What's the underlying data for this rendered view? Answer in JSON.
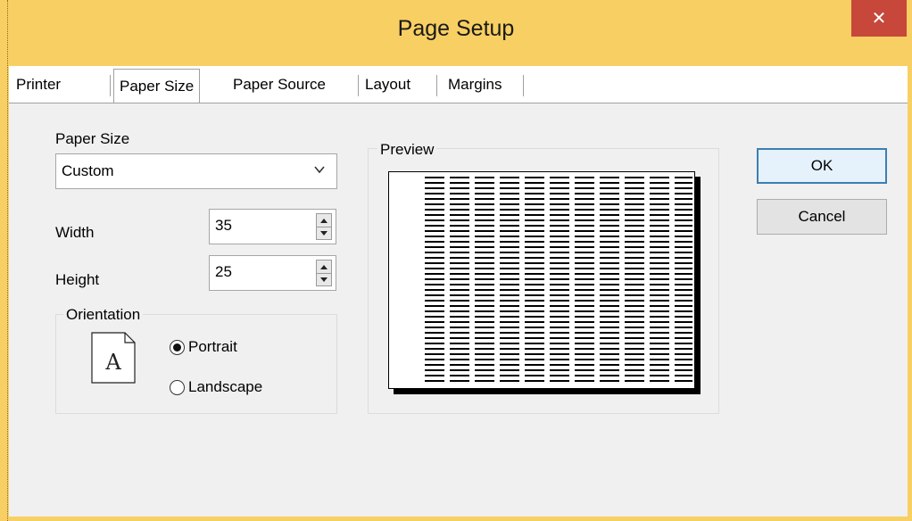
{
  "window": {
    "title": "Page Setup",
    "close_symbol": "✕",
    "accent": "#f8cf62",
    "close_color": "#c7473a"
  },
  "tabs": [
    {
      "label": "Printer",
      "active": false
    },
    {
      "label": "Paper Size",
      "active": true
    },
    {
      "label": "Paper Source",
      "active": false
    },
    {
      "label": "Layout",
      "active": false
    },
    {
      "label": "Margins",
      "active": false
    }
  ],
  "paper_size": {
    "label": "Paper Size",
    "selected": "Custom",
    "icon": "chevron-down-icon"
  },
  "width": {
    "label": "Width",
    "value": "35"
  },
  "height": {
    "label": "Height",
    "value": "25"
  },
  "orientation": {
    "title": "Orientation",
    "icon_letter": "A",
    "options": [
      {
        "label": "Portrait",
        "checked": true
      },
      {
        "label": "Landscape",
        "checked": false
      }
    ]
  },
  "preview": {
    "title": "Preview",
    "line_color": "#000000"
  },
  "buttons": {
    "ok": "OK",
    "cancel": "Cancel"
  }
}
